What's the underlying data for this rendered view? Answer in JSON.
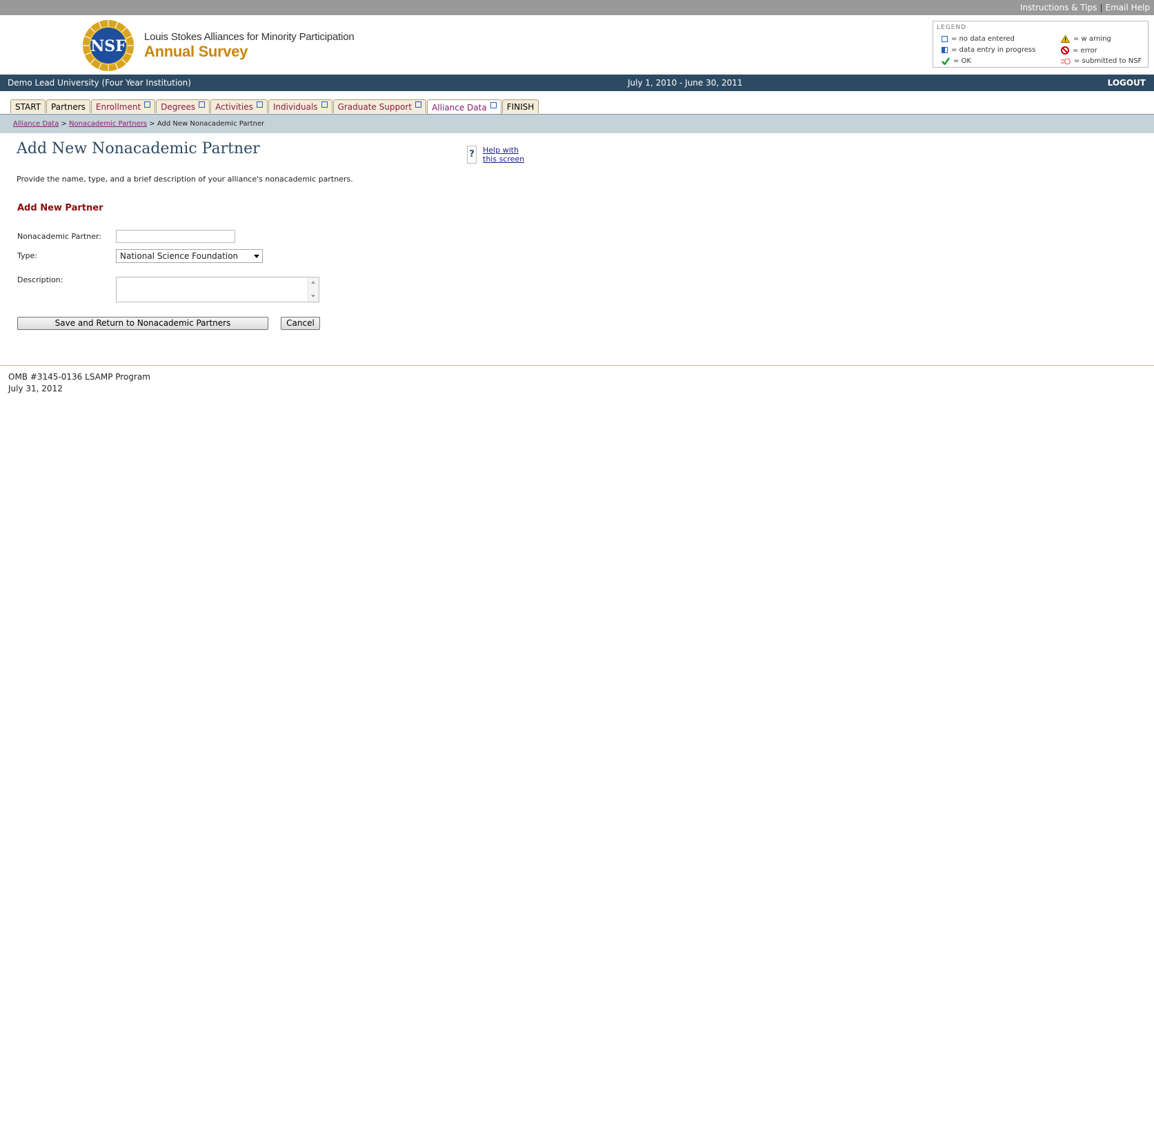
{
  "top_links": {
    "instructions": "Instructions & Tips",
    "separator": "|",
    "email": "Email Help"
  },
  "header": {
    "logo_text": "NSF",
    "title_line1": "Louis Stokes Alliances for Minority Participation",
    "title_line2": "Annual Survey"
  },
  "legend": {
    "heading": "LEGEND",
    "items": [
      {
        "icon": "empty-box-icon",
        "label": "= no data entered"
      },
      {
        "icon": "half-box-icon",
        "label": "= data entry in progress"
      },
      {
        "icon": "checkmark-icon",
        "label": "= OK"
      },
      {
        "icon": "warning-icon",
        "label": "= w arning"
      },
      {
        "icon": "error-icon",
        "label": "= error"
      },
      {
        "icon": "submitted-icon",
        "label": "= submitted to NSF"
      }
    ]
  },
  "infobar": {
    "institution": "Demo Lead University (Four Year Institution)",
    "period": "July 1, 2010 - June 30, 2011",
    "logout": "LOGOUT"
  },
  "tabs": [
    {
      "label": "START"
    },
    {
      "label": "Partners"
    },
    {
      "label": "Enrollment"
    },
    {
      "label": "Degrees"
    },
    {
      "label": "Activities"
    },
    {
      "label": "Individuals"
    },
    {
      "label": "Graduate Support"
    },
    {
      "label": "Alliance Data"
    },
    {
      "label": "FINISH"
    }
  ],
  "breadcrumb": {
    "link1": "Alliance Data",
    "sep": ">",
    "link2": "Nonacademic Partners",
    "current": "Add New Nonacademic Partner"
  },
  "page": {
    "title": "Add New Nonacademic Partner",
    "help_line1": "Help with",
    "help_line2": "this screen",
    "help_icon": "?",
    "intro": "Provide the name, type, and a brief description of your alliance's nonacademic partners.",
    "section_heading": "Add New Partner"
  },
  "form": {
    "partner_label": "Nonacademic Partner:",
    "partner_value": "",
    "type_label": "Type:",
    "type_value": "National Science Foundation",
    "description_label": "Description:",
    "description_value": "",
    "save_label": "Save and Return to Nonacademic Partners",
    "cancel_label": "Cancel"
  },
  "footer": {
    "line1": "OMB #3145-0136 LSAMP Program",
    "line2": "July 31, 2012"
  },
  "colors": {
    "navy": "#2d4a63",
    "gold": "#c8860d",
    "maroon": "#8b0d0d",
    "crumb_bg": "#c5d2da"
  }
}
